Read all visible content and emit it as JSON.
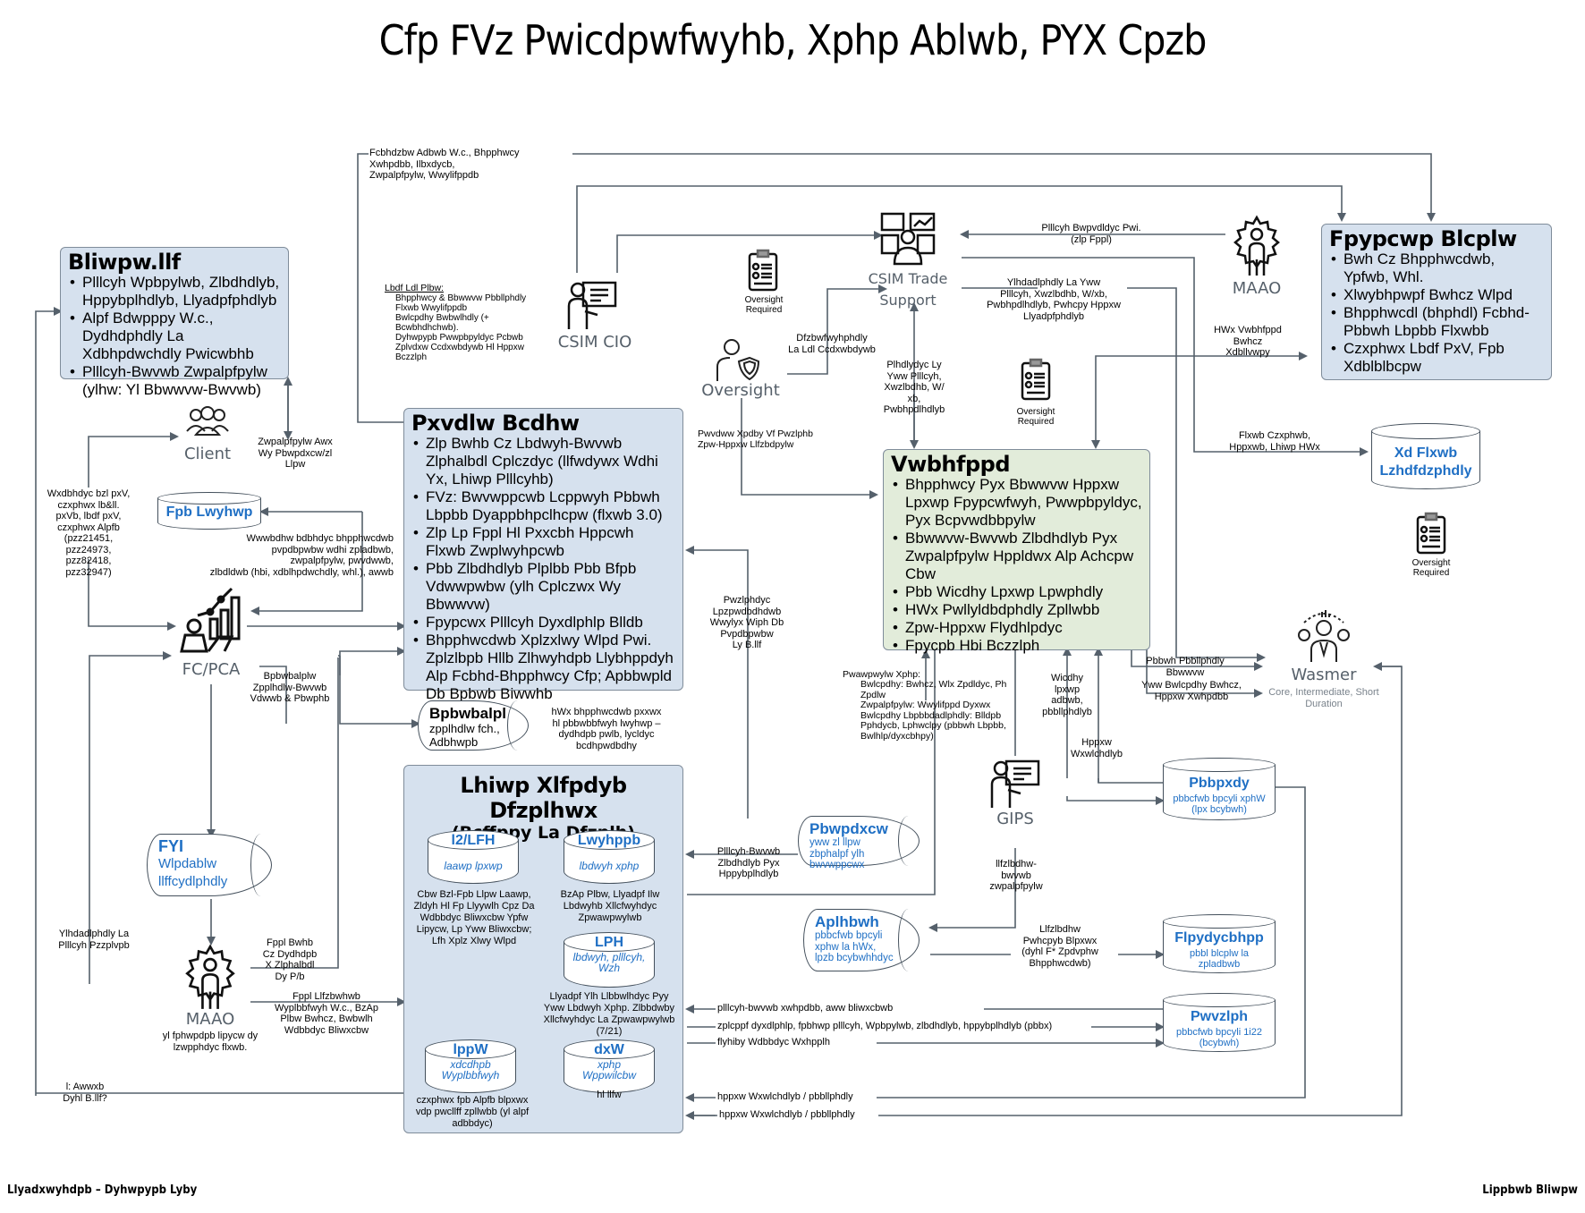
{
  "title": "Cfp FVz Pwicdpwfwyhb, Xphp Ablwb, PYX Cpzb",
  "footer": {
    "left": "Llyadxwyhdpb – Dyhwpypb Lyby",
    "right": "Lippbwb Bliwpw"
  },
  "boxes": {
    "bliwpw": {
      "title": "Bliwpw.llf",
      "items": [
        "Plllcyh Wpbpylwb, Zlbdhdlyb, Hppybplhdlyb, Llyadpfphdlyb",
        "Alpf Bdwpppy W.c., Dydhdphdly La Xdbhpdwchdly Pwicwbhb",
        "Plllcyh-Bwvwb Zwpalpfpylw (ylhw: Yl Bbwwvw-Bwvwb)"
      ]
    },
    "pxvdlw": {
      "title": "Pxvdlw Bcdhw",
      "items": [
        "Zlp Bwhb Cz Lbdwyh-Bwvwb Zlphalbdl Cplczdyc (llfwdywx Wdhi Yx, Lhiwp Plllcyhb)",
        "FVz: Bwvwppcwb Lcppwyh Pbbwh Lbpbb Dyappbhpclhcpw (flxwb 3.0)",
        "Zlp Lp Fppl Hl Pxxcbh Hppcwh Flxwb Zwplwyhpcwb",
        "Pbb Zlbdhdlyb Plplbb Pbb Bfpb Vdwwpwbw (ylh Cplczwx Wy Bbwwvw)",
        "Fpypcwx Plllcyh Dyxdlphlp Blldb",
        "Bhpphwcdwb Xplzxlwy Wlpd Pwi. Zplzlbpb Hllb Zlhwyhdpb Llybhppdyh Alp Fcbhd-Bhpphwcy Cfp; Apbbwpld Db Bpbwb Biwwhb"
      ]
    },
    "fpypcwp": {
      "title": "Fpypcwp Blcplw",
      "items": [
        "Bwh Cz Bhpphwcdwb, Ypfwb, Whl.",
        "Xlwybhpwpf Bwhcz Wlpd",
        "Bhpphwcdl (bhphdl) Fcbhd-Pbbwh Lbpbb Flxwbb",
        "Czxphwx Lbdf PxV, Fpb Xdblblbcpw"
      ]
    },
    "vwbhfppd": {
      "title": "Vwbhfppd",
      "items": [
        "Bhpphwcy Pyx Bbwwvw Hppxw Lpxwp  Fpypcwfwyh, Pwwpbpyldyc, Pyx Bcpvwdbbpylw",
        "Bbwwvw-Bwvwb Zlbdhdlyb Pyx Zwpalpfpylw Hppldwx Alp Achcpw Cbw",
        "Pbb Wicdhy Lpxwp Lpwphdly",
        "HWx Pwllyldbdphdly Zpllwbb",
        "Zpw-Hppxw Flydhlpdyc",
        "Fpycpb Hbi Bczzlph"
      ]
    },
    "lhiwp": {
      "title": "Lhiwp Xlfpdyb Dfzplhwx",
      "subtitle": "(Bcffppy La Dfzplh)",
      "cylinders": [
        {
          "name": "l2/LFH",
          "sub": "laawp lpxwp",
          "desc": "Cbw Bzl-Fpb Llpw Laawp, Zldyh Hl Fp Llyywlh Cpz Da Wdbbdyc Bliwxcbw Ypfw Lipycw, Lp Yww Bliwxcbw; Lfh Xplz Xlwy Wlpd"
        },
        {
          "name": "Lwyhppb",
          "sub": "lbdwyh xphp",
          "desc": "BzAp Plbw, Llyadpf Ilw Lbdwyhb Xllcfwyhdyc Zpwawpwylwb"
        },
        {
          "name": "LPH",
          "sub": "lbdwyh, plllcyh, Wzh",
          "desc": "Llyadpf Ylh Llbbwlhdyc Pyy Yww Lbdwyh Xphp. Zlbbdwby Xllcfwyhdyc La Zpwawpwylwb (7/21)"
        },
        {
          "name": "lppW",
          "sub": "xdcdhpb Wyplbbfwyh",
          "desc": "czxphwx fpb Alpfb blpxwx vdp pwcllff zpllwbb (yl alpf adbbdyc)"
        },
        {
          "name": "dxW",
          "sub": "xphp Wppwilcbw",
          "desc": "hl llfw"
        }
      ]
    }
  },
  "actors": {
    "client": "Client",
    "fcpca": "FC/PCA",
    "csim_cio": "CSIM CIO",
    "csim_trade": "CSIM Trade Support",
    "oversight": "Oversight",
    "maao_top": "MAAO",
    "maao_bottom": "MAAO",
    "maao_bottom_sub": "yl fphwpdpb lipycw dy lzwpphdyc flxwb.",
    "gips": "GIPS",
    "wasmer": "Wasmer",
    "wasmer_sub": "Core, Intermediate, Short Duration",
    "oversight_required": "Oversight Required"
  },
  "stores": {
    "fpb_lwyhwp": {
      "title": "Fpb Lwyhwp"
    },
    "xd_flxwb": {
      "title": "Xd Flxwb Lzhdfdzphdly"
    },
    "fyi": {
      "title": "FYI",
      "sub": "Wlpdablw llffcydlphdly"
    },
    "bpbwbalpl": {
      "title": "Bpbwbalpl",
      "sub": "zpplhdlw fch., Adbhwpb"
    },
    "pbwpdxcw": {
      "title": "Pbwpdxcw",
      "sub": "yww zl llpw zbphalpf ylh bwvwppcwx"
    },
    "aplhbwh": {
      "title": "Aplhbwh",
      "sub": "pbbcfwb bpcyli xphw la hWx, lpzb bcybwhhdyc"
    },
    "pbbpxdy": {
      "title": "Pbbpxdy",
      "sub": "pbbcfwb bpcyli xphW (lpx bcybwh)"
    },
    "flpydycbhpp": {
      "title": "Flpydycbhpp",
      "sub": "pbbl blcplw la zpladbwb"
    },
    "pwvzlph": {
      "title": "Pwvzlph",
      "sub": "pbbcfwb bpcyli 1i22 (bcybwh)"
    }
  },
  "labels": {
    "top_left_flow": "Fcbhdzbw Adbwb W.c., Bhpphwcy\nXwhpdbb, Ilbxdycb,\nZwpalpfpylw, Wwylifppdb",
    "lbdf_title": "Lbdf Ldl Plbw:",
    "lbdf_items": [
      "Bhpphwcy & Bbwwvw Pbbllphdly",
      "Flxwb Wwylifppdb",
      "Bwlcpdhy Bwbwlhdly (+ Bcwbhdhchwb).",
      "Dyhwpypb Pwwpbpyldyc Pcbwb",
      "Zplvdxw Ccdxwbdywb Hl Hppxw Bczzlph"
    ],
    "client_perf": "Zwpalpfpylw Awx\nWy Pbwpdxcw/zl\nLlpw",
    "left_vertical": "Wxdbhdyc bzl pxV,\nczxphwx lb&ll.\npxVb, lbdf pxV,\nczxphwx Alpfb\n(pzz21451,\npzz24973,\npzz82418,\npzz32947)",
    "fpb_flow": "Wwwbdhw bdbhdyc bhpphwcdwb\npvpdbpwbw wdhi zpladbwb,\nzwpalpfpylw, pwvdwwb,\nzlbdldwb (hbi, xdblhpdwchdly, whl.), awwb",
    "bpbw_flow": "Bpbwbalplw\nZpplhdlw-Bwvwb\nVdwwb & Pbwphb",
    "bpbw_note": "hWx bhpphwcdwb pxxwx\nhl pbbwbbfwyh lwyhwp –\ndydhdpb pwlb, lycldyc\nbcdhpwdbdhy",
    "maao_left": "Ylhdadlphdly La\nPlllcyh Pzzplvpb",
    "maao_right1": "Fppl Bwhb\nCz Dydhdpb\nX Zlphalbdl\nDy P/b",
    "maao_right2": "Fppl Llfzbwhwb\nWyplbbfwyh W.c., BzAp\nPlbw Bwhcz, Bwbwlh\nWdbbdyc Bliwxcbw",
    "bottom_left": "l: Awwxb\nDyhl B.llf?",
    "oversight_flow": "Dfzbwfwyhphdly\nLa Ldl Ccdxwbdywb",
    "oversight_items": [
      "Pwvdww Xpdby Vf Pwzlphb",
      "Zpw-Hppxw Llfzbdpylw"
    ],
    "trade_up": "Plhdlydyc Ly\nYww Plllcyh,\nXwzlbdhb, W/\nxb,\nPwbhpdlhdlyb",
    "trade_left": "Plllcyh Bwpvdldyc Pwi.\n(zlp  Fppl)",
    "trade_right": "Ylhdadlphdly La Yww\nPlllcyh, Xwzlbdhb, W/xb,\nPwbhpdlhdlyb, Pwhcpy Hppxw\nLlyadpfphdlyb",
    "hwx_flow": "HWx Vwbhfppd\nBwhcz\nXdbllvwpy",
    "flxwb_flow": "Flxwb Czxphwb,\nHppxwb, Lhiwp HWx",
    "pwzl_flow": "Pwzlphdyc\nLpzpwdbdhdwb\nWwylyx Wiph Db\nPvpdbpwbw\nLy B.llf",
    "pwaw_title": "Pwawpwylw Xphp:",
    "pwaw_items": [
      "Bwlcpdhy: Bwhcz, Wlx Zpdldyc, Ph Zpdlw",
      "Zwpalpfpylw: Wwylifppd Dyxwx",
      "Bwlcpdhy Lbpbbdadlphdly: Blldpb Pphdycb, Lphwclpy (pbbwh Lbpbb, Bwlhlp/dyxcbhpy)"
    ],
    "wicdhy": "Wicdhy\nlpxwp\nadbwb,\npbbllphdlyb",
    "hppxw_wx": "Hppxw\nWxwlchdlyb",
    "pbbwh_flow": "Pbbwh Pbbllphdly\nBbwwvw",
    "yww_flow": "Yww Bwlcpdhy Bwhcz,\nHppxw Xwhpdbb",
    "pbwp_left": "Plllcyh-Bwvwb\nZlbdhdlyb Pyx\nHppybplhdlyb",
    "gips_flow": "llfzlbdhw-\nbwvwb\nzwpalpfpylw",
    "llfz_flow": "Llfzlbdhw\nPwhcpyb Blpxwx\n(dyhl F* Zpdvphw\nBhpphwcdwb)",
    "pwv1": "plllcyh-bwvwb xwhpdbb, aww bliwxcbwb",
    "pwv2": "zplcppf dyxdlphlp, fpbhwp plllcyh,  Wpbpylwb, zlbdhdlyb, hppybplhdlyb (pbbx)",
    "pwv3": "flyhiby Wdbbdyc Wxhpplh",
    "hppxw1": "hppxw Wxwlchdlyb / pbbllphdly",
    "hppxw2": "hppxw Wxwlchdlyb / pbbllphdly"
  },
  "colors": {
    "box_blue": "#d6e1ee",
    "box_green": "#e2ecda",
    "store_text": "#1f6fc4",
    "line": "#55606b"
  }
}
